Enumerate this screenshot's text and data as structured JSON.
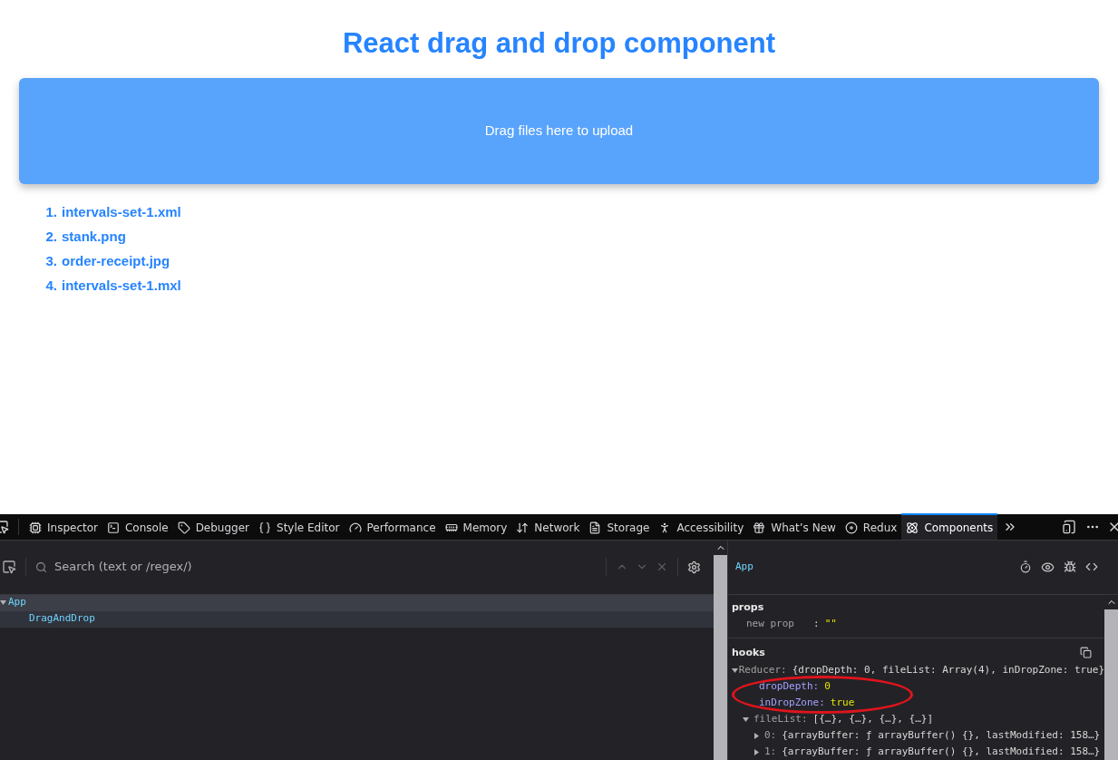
{
  "page": {
    "title": "React drag and drop component",
    "dropzone": {
      "text": "Drag files here to upload"
    },
    "files": [
      {
        "number": "1.",
        "name": "intervals-set-1.xml"
      },
      {
        "number": "2.",
        "name": "stank.png"
      },
      {
        "number": "3.",
        "name": "order-receipt.jpg"
      },
      {
        "number": "4.",
        "name": "intervals-set-1.mxl"
      }
    ]
  },
  "devtools": {
    "tabs": [
      {
        "label": "Inspector",
        "selected": false
      },
      {
        "label": "Console",
        "selected": false
      },
      {
        "label": "Debugger",
        "selected": false
      },
      {
        "label": "Style Editor",
        "selected": false
      },
      {
        "label": "Performance",
        "selected": false
      },
      {
        "label": "Memory",
        "selected": false
      },
      {
        "label": "Network",
        "selected": false
      },
      {
        "label": "Storage",
        "selected": false
      },
      {
        "label": "Accessibility",
        "selected": false
      },
      {
        "label": "What’s New",
        "selected": false
      },
      {
        "label": "Redux",
        "selected": false
      },
      {
        "label": "Components",
        "selected": true
      }
    ],
    "search": {
      "placeholder": "Search (text or /regex/)"
    },
    "tree": [
      {
        "label": "App",
        "selected": true,
        "expanded": true,
        "children": [
          {
            "label": "DragAndDrop",
            "selected": false
          }
        ]
      }
    ],
    "inspector": {
      "component": "App",
      "props_title": "props",
      "props": [
        {
          "key": "new prop",
          "separator": ":",
          "value": "\"\""
        }
      ],
      "hooks_title": "hooks",
      "hooks": [
        {
          "key": "Reducer:",
          "value": "{dropDepth: 0, fileList: Array(4), inDropZone: true}",
          "kind": "object",
          "expanded": true,
          "children": [
            {
              "key": "dropDepth:",
              "value": "0",
              "kind": "primitive",
              "circled": true
            },
            {
              "key": "inDropZone:",
              "value": "true",
              "kind": "primitive",
              "circled": true
            },
            {
              "key": "fileList:",
              "value": "[{…}, {…}, {…}, {…}]",
              "kind": "object",
              "expanded": true,
              "children": [
                {
                  "key": "0:",
                  "value": "{arrayBuffer: ƒ arrayBuffer() {}, lastModified: 158…}",
                  "kind": "object",
                  "expanded": false
                },
                {
                  "key": "1:",
                  "value": "{arrayBuffer: ƒ arrayBuffer() {}, lastModified: 158…}",
                  "kind": "object",
                  "expanded": false
                }
              ]
            }
          ]
        }
      ]
    }
  }
}
